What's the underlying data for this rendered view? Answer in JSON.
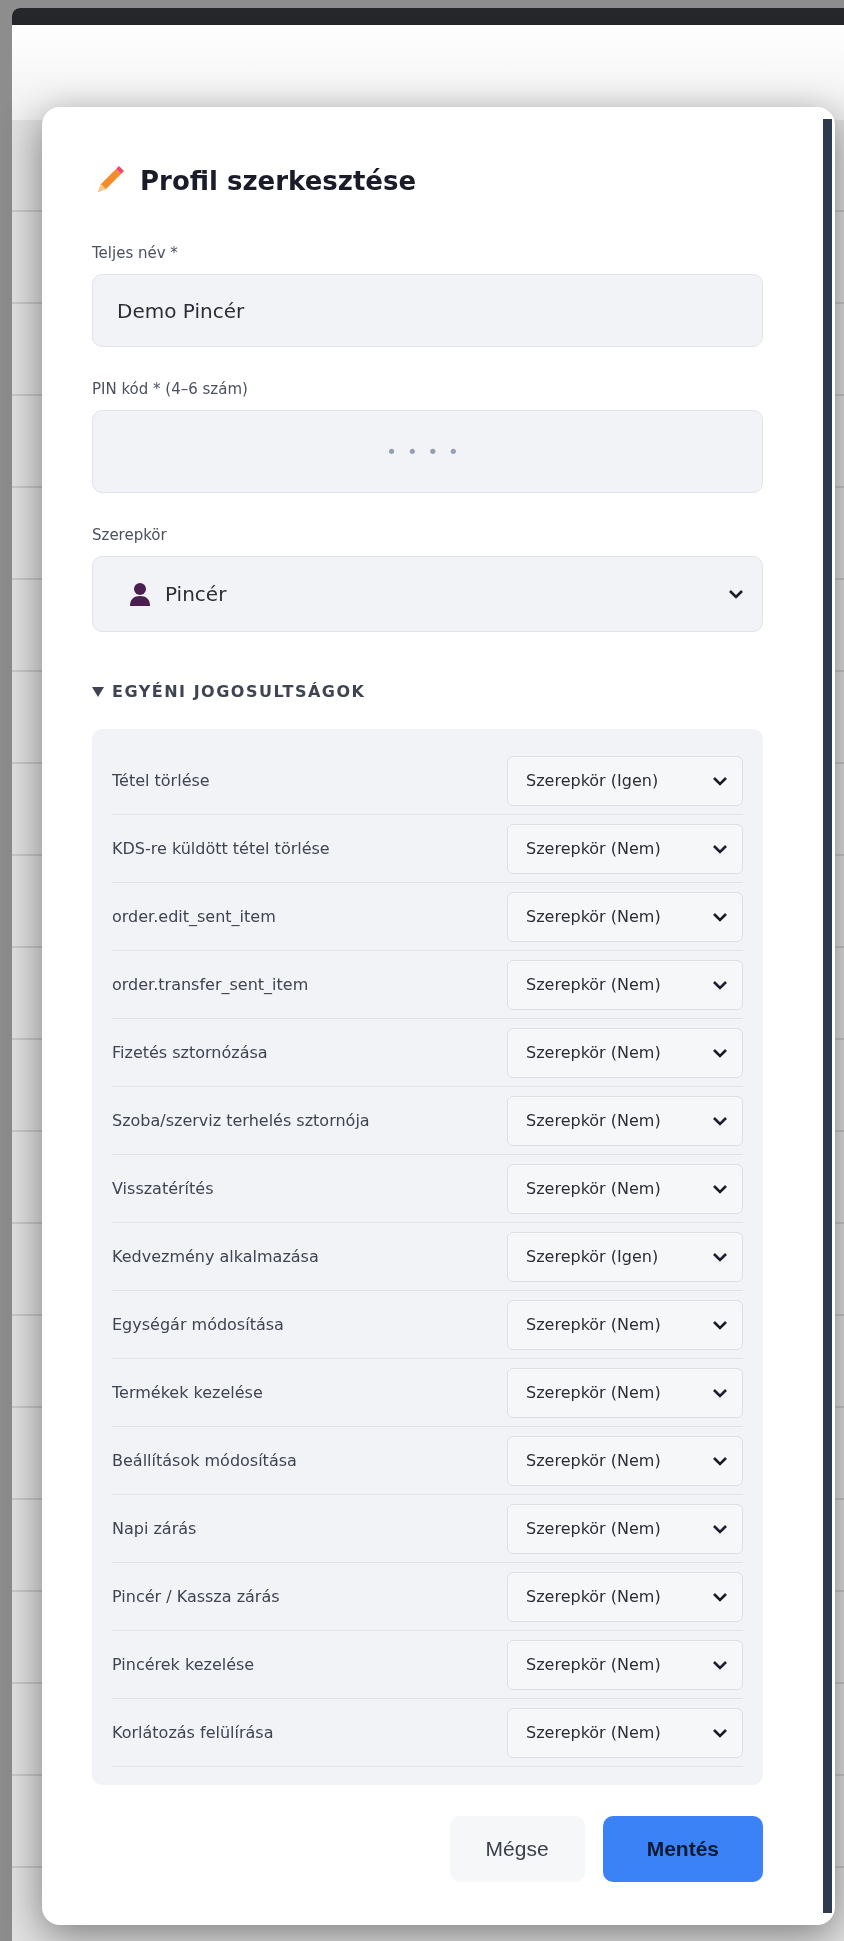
{
  "dialog": {
    "title": "Profil szerkesztése",
    "full_name": {
      "label": "Teljes név *",
      "value": "Demo Pincér"
    },
    "pin": {
      "label": "PIN kód * (4–6 szám)",
      "value": "••••"
    },
    "role": {
      "label": "Szerepkör",
      "value": "Pincér"
    },
    "permissions": {
      "title": "EGYÉNI JOGOSULTSÁGOK",
      "expanded": true,
      "items": [
        {
          "label": "Tétel törlése",
          "value": "Szerepkör (Igen)"
        },
        {
          "label": "KDS-re küldött tétel törlése",
          "value": "Szerepkör (Nem)"
        },
        {
          "label": "order.edit_sent_item",
          "value": "Szerepkör (Nem)"
        },
        {
          "label": "order.transfer_sent_item",
          "value": "Szerepkör (Nem)"
        },
        {
          "label": "Fizetés sztornózása",
          "value": "Szerepkör (Nem)"
        },
        {
          "label": "Szoba/szerviz terhelés sztornója",
          "value": "Szerepkör (Nem)"
        },
        {
          "label": "Visszatérítés",
          "value": "Szerepkör (Nem)"
        },
        {
          "label": "Kedvezmény alkalmazása",
          "value": "Szerepkör (Igen)"
        },
        {
          "label": "Egységár módosítása",
          "value": "Szerepkör (Nem)"
        },
        {
          "label": "Termékek kezelése",
          "value": "Szerepkör (Nem)"
        },
        {
          "label": "Beállítások módosítása",
          "value": "Szerepkör (Nem)"
        },
        {
          "label": "Napi zárás",
          "value": "Szerepkör (Nem)"
        },
        {
          "label": "Pincér / Kassza zárás",
          "value": "Szerepkör (Nem)"
        },
        {
          "label": "Pincérek kezelése",
          "value": "Szerepkör (Nem)"
        },
        {
          "label": "Korlátozás felülírása",
          "value": "Szerepkör (Nem)"
        }
      ]
    },
    "buttons": {
      "cancel": "Mégse",
      "save": "Mentés"
    }
  }
}
